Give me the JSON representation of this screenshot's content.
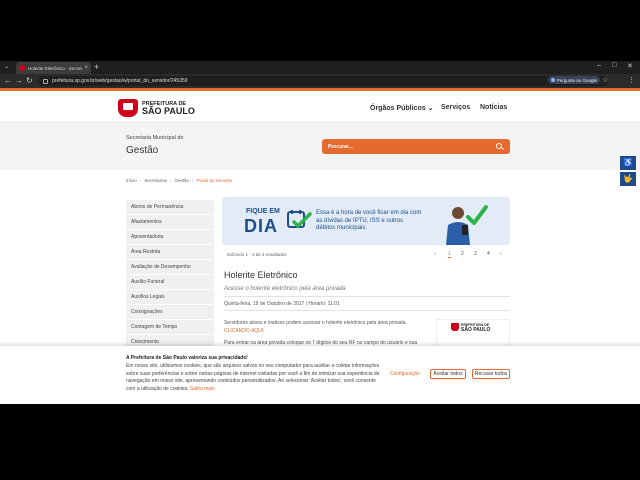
{
  "browser": {
    "tab_title": "Holerite Eletrônico - Secretaria",
    "tab_close": "×",
    "new_tab": "+",
    "tab_menu": "⌄",
    "url": "prefeitura.sp.gov.br/web/gestao/w/portal_do_servidor/245359",
    "google_button": "Pergunte ao Google",
    "minimize": "–",
    "maximize": "□",
    "close": "✕",
    "back": "←",
    "forward": "→",
    "reload": "↻",
    "star": "☆",
    "menu": "⋮"
  },
  "header": {
    "logo_line1": "PREFEITURA DE",
    "logo_line2": "SÃO PAULO",
    "nav": [
      {
        "label": "Órgãos Públicos ⌄"
      },
      {
        "label": "Serviços"
      },
      {
        "label": "Notícias"
      }
    ]
  },
  "department": {
    "label": "Secretaria Municipal de",
    "title": "Gestão"
  },
  "search": {
    "placeholder": "Procurar..."
  },
  "breadcrumb": [
    "Início",
    "Secretarias",
    "Gestão",
    "Portal do Servidor"
  ],
  "sidebar": {
    "items": [
      "Abono de Permanência",
      "Afastamentos",
      "Aposentadoria",
      "Área Restrita",
      "Avaliação de Desempenho",
      "Auxílio Funeral",
      "Auxílios Legais",
      "Consignações",
      "Contagem de Tempo",
      "Crescimento"
    ]
  },
  "banner": {
    "fique": "FIQUE EM",
    "dia": "DIA",
    "text": "Essa é a hora de você ficar em dia com as dívidas de IPTU, ISS e outros débitos municipais."
  },
  "pager": {
    "info": "Exibindo 1 - 1 de 4 resultados",
    "prev": "‹",
    "next": "›",
    "pages": [
      "1",
      "2",
      "3",
      "4"
    ],
    "current": "1"
  },
  "article": {
    "title": "Holerite Eletrônico",
    "subtitle": "Acesse o holerite eletrônico pela área privada",
    "date": "Quinta-feira, 19 de Outubro de 2017 | Horário: 11:01",
    "p1_text": "Servidores ativos e inativos podem acessar o holerite eletrônico pela área privada.",
    "p1_link": "CLICANDO AQUI.",
    "p2_text": "Para entrar na área privada coloque os 7 dígitos do seu RF no campo do usuário e sua"
  },
  "doc_thumb": {
    "line1": "PREFEITURA DE",
    "line2": "SÃO PAULO"
  },
  "side_widgets": [
    "♿",
    "🤟"
  ],
  "cookie": {
    "title": "A Prefeitura de São Paulo valoriza sua privacidade!",
    "text": "Em nosso site, utilizamos cookies, que são arquivos salvos no seu computador para auxiliar a coletar informações sobre suas preferências e sobre outras páginas de internet visitadas por você a fim de otimizar sua experiência de navegação em nosso site, apresentando conteúdos personalizados. Ao selecionar 'Aceitar todos', você consente com a utilização de cookies.",
    "link": "Saiba mais",
    "config": "Configuração",
    "accept": "Aceitar todos",
    "reject": "Recusar todos"
  },
  "colors": {
    "accent": "#e56a2f",
    "brand_blue": "#1c4f8b",
    "brand_red": "#d0021b"
  }
}
